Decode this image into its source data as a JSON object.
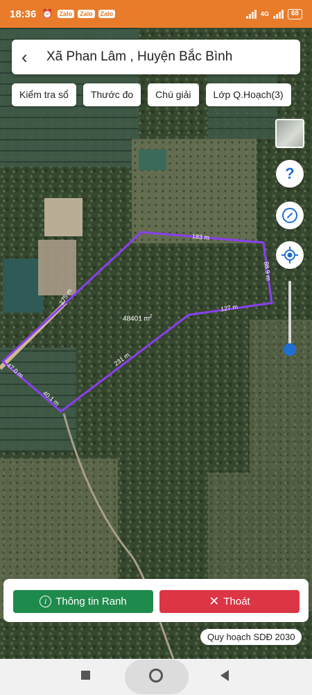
{
  "status_bar": {
    "time": "18:36",
    "notification_labels": [
      "Zalo",
      "Zalo",
      "Zalo"
    ],
    "network": "4G",
    "battery": "68"
  },
  "header": {
    "back_icon": "chevron-left-icon",
    "title": "Xã Phan Lâm , Huyện Bắc Bình"
  },
  "toolbar": {
    "chips": [
      "Kiểm tra sổ",
      "Thước đo",
      "Chú giải",
      "Lớp Q.Hoạch(3)"
    ]
  },
  "map_controls": {
    "layer_icon": "map-layer-icon",
    "help_label": "?",
    "compass_icon": "compass-icon",
    "locate_icon": "my-location-icon",
    "zoom_level": 0.05
  },
  "parcel": {
    "area_value": "48401 m",
    "area_unit_sup": "2",
    "edge_labels": [
      "183 m",
      "88.9 m",
      "127 m",
      "231 m",
      "40.1 m",
      "47.0 m",
      "275 m"
    ],
    "outline_color": "#8a3ff2"
  },
  "actions": {
    "info_button": "Thông tin Ranh",
    "exit_button": "Thoát",
    "info_color": "#1e8b4c",
    "exit_color": "#dc3545"
  },
  "plan_label": "Quy hoạch SDĐ 2030"
}
